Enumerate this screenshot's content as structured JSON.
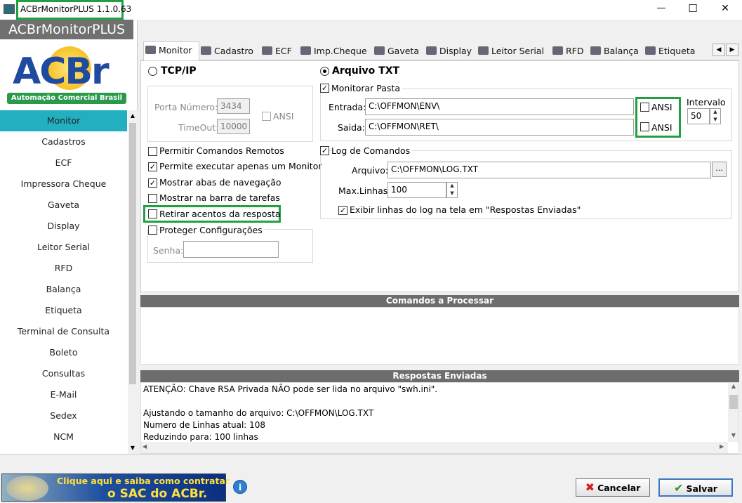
{
  "window": {
    "title": "ACBrMonitorPLUS 1.1.0.63",
    "minimize_glyph": "—",
    "maximize_glyph": "☐",
    "close_glyph": "✕"
  },
  "sidebar": {
    "app_name": "ACBrMonitorPLUS",
    "logo_text": "ACBr",
    "logo_subtitle": "Automação Comercial Brasil",
    "items": [
      "Monitor",
      "Cadastros",
      "ECF",
      "Impressora Cheque",
      "Gaveta",
      "Display",
      "Leitor Serial",
      "RFD",
      "Balança",
      "Etiqueta",
      "Terminal de Consulta",
      "Boleto",
      "Consultas",
      "E-Mail",
      "Sedex",
      "NCM"
    ],
    "active_index": 0
  },
  "tabs": [
    "Monitor",
    "Cadastro",
    "ECF",
    "Imp.Cheque",
    "Gaveta",
    "Display",
    "Leitor Serial",
    "RFD",
    "Balança",
    "Etiqueta"
  ],
  "tcp": {
    "radio_label": "TCP/IP",
    "porta_label": "Porta Número:",
    "porta_value": "3434",
    "timeout_label": "TimeOut:",
    "timeout_value": "10000",
    "ansi_label": "ANSI"
  },
  "options": {
    "permitir_remotos": "Permitir Comandos Remotos",
    "apenas_um_monitor": "Permite executar apenas um Monitor",
    "mostrar_abas": "Mostrar abas de navegação",
    "mostrar_barra": "Mostrar na barra de tarefas",
    "retirar_acentos": "Retirar acentos da resposta",
    "proteger": "Proteger Configurações",
    "senha_label": "Senha:"
  },
  "txt": {
    "radio_label": "Arquivo TXT",
    "monitorar_label": "Monitorar Pasta",
    "entrada_label": "Entrada:",
    "entrada_value": "C:\\OFFMON\\ENV\\",
    "saida_label": "Saida:",
    "saida_value": "C:\\OFFMON\\RET\\",
    "ansi_label": "ANSI",
    "intervalo_label": "Intervalo",
    "intervalo_value": "50"
  },
  "log": {
    "label": "Log de Comandos",
    "arquivo_label": "Arquivo:",
    "arquivo_value": "C:\\OFFMON\\LOG.TXT",
    "browse": "...",
    "max_label": "Max.Linhas:",
    "max_value": "100",
    "exibir_label": "Exibir linhas do log na tela em \"Respostas Enviadas\""
  },
  "comandos_header": "Comandos a Processar",
  "respostas_header": "Respostas Enviadas",
  "respostas_lines": [
    "ATENÇÃO: Chave RSA Privada NÃO pode ser lida no arquivo \"swh.ini\".",
    "",
    "Ajustando o tamanho do arquivo: C:\\OFFMON\\LOG.TXT",
    "Numero de Linhas atual: 108",
    "Reduzindo para: 100 linhas"
  ],
  "footer": {
    "banner_line1": "Clique aqui e saiba como contratar",
    "banner_line2": "o SAC do ACBr.",
    "cancel_label": "Cancelar",
    "save_label": "Salvar"
  },
  "colors": {
    "accent_teal": "#22b0c0",
    "highlight_green": "#20a040",
    "header_gray": "#6d6d6d"
  }
}
